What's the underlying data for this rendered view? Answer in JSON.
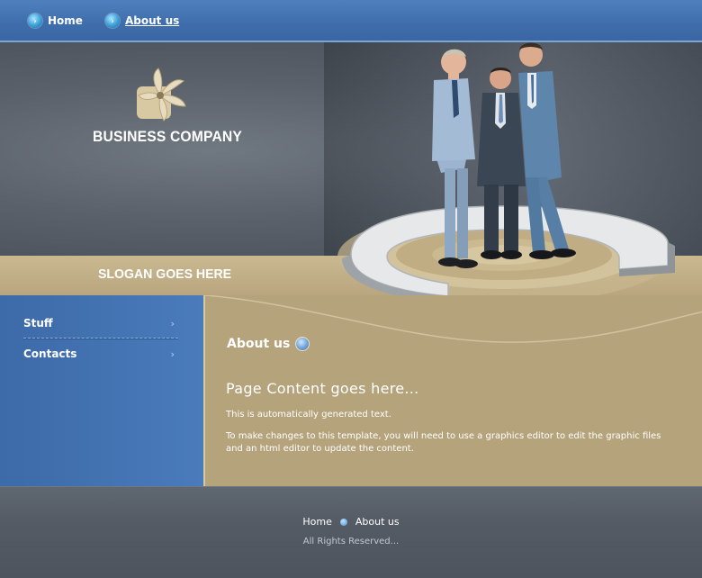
{
  "nav": {
    "items": [
      {
        "label": "Home"
      },
      {
        "label": "About us"
      }
    ]
  },
  "header": {
    "company_name": "BUSINESS COMPANY",
    "slogan": "SLOGAN GOES HERE"
  },
  "sidebar": {
    "items": [
      {
        "label": "Stuff",
        "arrow": "›"
      },
      {
        "label": "Contacts",
        "arrow": "›"
      }
    ]
  },
  "content": {
    "section_title": "About us",
    "heading": "Page Content goes here...",
    "paragraph1": "This is automatically generated text.",
    "paragraph2": "To make changes to this template, you will need to use a graphics editor to edit the graphic files and an html editor to update the content."
  },
  "footer": {
    "links": [
      {
        "label": "Home"
      },
      {
        "label": "About us"
      }
    ],
    "copyright": "All Rights Reserved..."
  },
  "colors": {
    "nav_blue": "#3f6dab",
    "sidebar_blue": "#4374b4",
    "tan": "#b5a37c",
    "footer_gray": "#545b64"
  }
}
